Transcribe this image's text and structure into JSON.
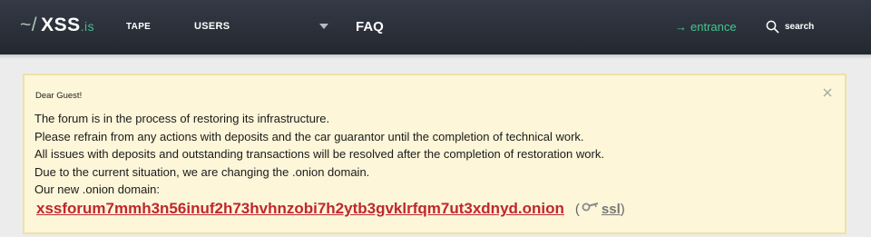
{
  "header": {
    "logo": {
      "tilde": "~/",
      "name": "XSS",
      "tld": ".is"
    },
    "nav": {
      "tape": "TAPE",
      "users": "USERS",
      "faq": "FAQ"
    },
    "entrance": {
      "arrow": "→",
      "label": "entrance"
    },
    "search": {
      "label": "search"
    },
    "colors": {
      "background": "#2b3039",
      "accent": "#46c48e"
    }
  },
  "notice": {
    "greeting": "Dear Guest!",
    "lines": [
      "The forum is in the process of restoring its infrastructure.",
      "Please refrain from any actions with deposits and the car guarantor until the completion of technical work.",
      "All issues with deposits and outstanding transactions will be resolved after the completion of restoration work.",
      "Due to the current situation, we are changing the .onion domain.",
      "Our new .onion domain:"
    ],
    "onion_link": "xssforum7mmh3n56inuf2h73hvhnzobi7h2ytb3gvklrfqm7ut3xdnyd.onion",
    "ssl": {
      "open": "(",
      "label": "ssl",
      "close": ")"
    },
    "colors": {
      "background": "#fdf6d9",
      "border": "#f0e1a6",
      "link": "#c0272d"
    }
  }
}
